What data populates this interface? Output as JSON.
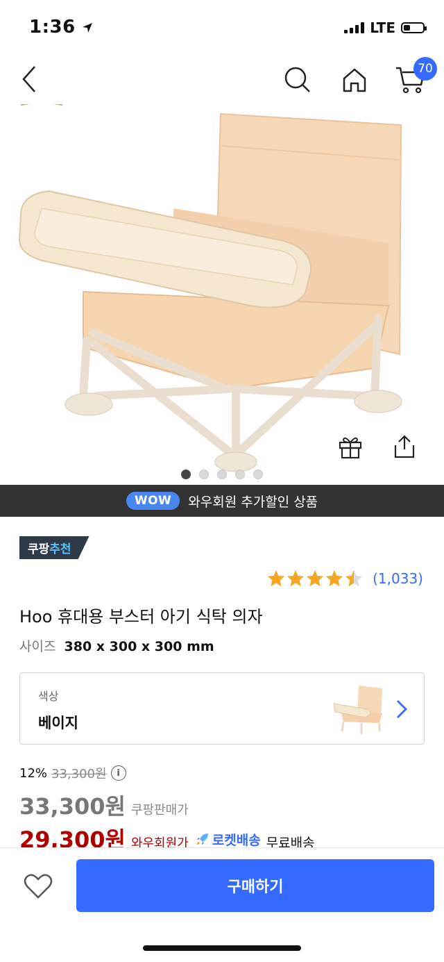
{
  "status_bar": {
    "time": "1:36",
    "network": "LTE",
    "battery_level": 0.35
  },
  "nav": {
    "cart_count": "70"
  },
  "gallery": {
    "total_images": 5,
    "active_index": 0
  },
  "wow_banner": {
    "badge": "WOW",
    "text": "와우회원 추가할인 상품"
  },
  "recommend_tag": {
    "prefix": "쿠팡",
    "highlight": "추천"
  },
  "rating": {
    "stars": 4.5,
    "count": "(1,033)"
  },
  "product": {
    "title": "Hoo 휴대용 부스터 아기 식탁 의자",
    "size_label": "사이즈",
    "size_value": "380 x 300 x 300 mm"
  },
  "option": {
    "label": "색상",
    "value": "베이지"
  },
  "pricing": {
    "discount_rate": "12%",
    "original_price": "33,300원",
    "sale_price": "33,300원",
    "sale_label": "쿠팡판매가",
    "wow_price": "29,300원",
    "wow_label": "와우회원가",
    "rocket_label": "로켓배송",
    "shipping": "무료배송"
  },
  "actions": {
    "buy_label": "구매하기"
  },
  "colors": {
    "accent": "#346aff",
    "wow_red": "#ae0000",
    "banner_bg": "#333333",
    "star": "#f5a623"
  }
}
